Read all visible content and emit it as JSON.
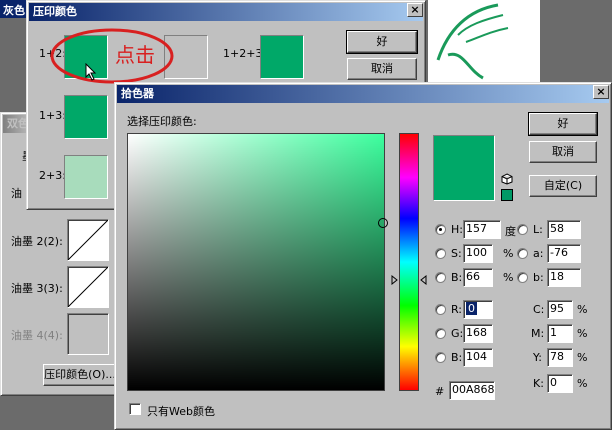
{
  "colors": {
    "picked": "#00A868",
    "light": "#a8dcbc",
    "empty": "#c0c0c0",
    "annotation": "#d82020"
  },
  "back_window": {
    "title_fragment": "双色"
  },
  "top_left_fragment": "灰色",
  "overprint_dialog": {
    "title": "压印颜色",
    "labels": {
      "pair_12": "1+2:",
      "pair_13": "1+3:",
      "pair_23": "2+3:",
      "triple": "1+2+3:"
    },
    "ok": "好",
    "cancel": "取消",
    "annotation": "点击"
  },
  "duotone_dialog": {
    "label_partial": "油",
    "label_partial_2": "墨",
    "ink2": "油墨 2(2):",
    "ink3": "油墨 3(3):",
    "ink4": "油墨 4(4):",
    "overprint_button": "压印颜色(O)..."
  },
  "color_picker": {
    "title": "拾色器",
    "prompt": "选择压印颜色:",
    "ok": "好",
    "cancel": "取消",
    "custom": "自定(C)",
    "fields": {
      "H": {
        "label": "H:",
        "value": "157",
        "unit": "度"
      },
      "S": {
        "label": "S:",
        "value": "100",
        "unit": "%"
      },
      "B": {
        "label": "B:",
        "value": "66",
        "unit": "%"
      },
      "R": {
        "label": "R:",
        "value": "0"
      },
      "G": {
        "label": "G:",
        "value": "168"
      },
      "Bl": {
        "label": "B:",
        "value": "104"
      },
      "L": {
        "label": "L:",
        "value": "58"
      },
      "a": {
        "label": "a:",
        "value": "-76"
      },
      "b": {
        "label": "b:",
        "value": "18"
      },
      "C": {
        "label": "C:",
        "value": "95",
        "unit": "%"
      },
      "M": {
        "label": "M:",
        "value": "1",
        "unit": "%"
      },
      "Y": {
        "label": "Y:",
        "value": "78",
        "unit": "%"
      },
      "K": {
        "label": "K:",
        "value": "0",
        "unit": "%"
      }
    },
    "hex_label": "#",
    "hex_value": "00A868",
    "web_only": "只有Web颜色",
    "selected_radio": "H"
  }
}
